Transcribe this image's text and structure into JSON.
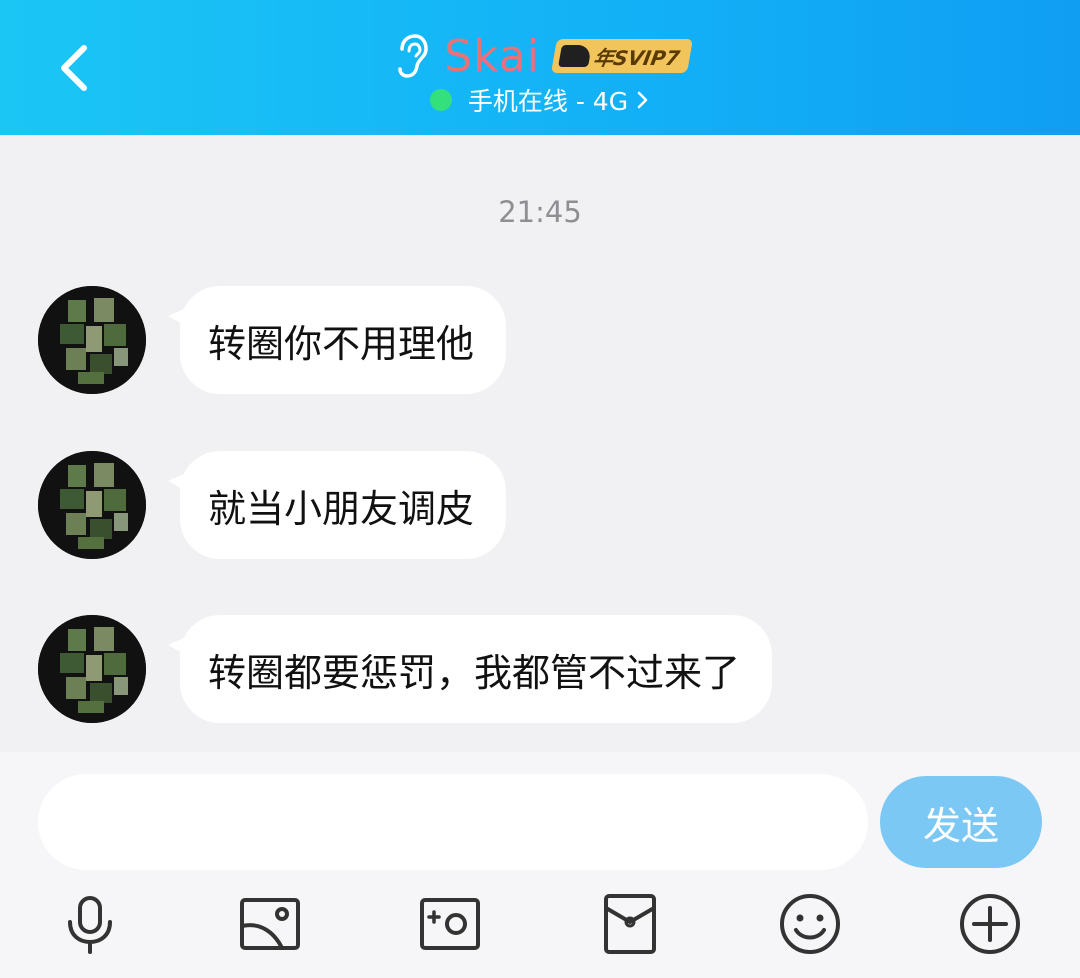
{
  "header": {
    "contact_name": "Skai",
    "vip_badge": "年SVIP7",
    "status": "手机在线 - 4G",
    "status_dot_color": "#34e07b"
  },
  "chat": {
    "timestamp": "21:45",
    "messages": [
      {
        "text": "转圈你不用理他"
      },
      {
        "text": "就当小朋友调皮"
      },
      {
        "text": "转圈都要惩罚，我都管不过来了"
      }
    ]
  },
  "composer": {
    "input_value": "",
    "placeholder": "",
    "send_label": "发送",
    "send_color": "#7cc8f4"
  },
  "toolbar": {
    "icons": [
      "microphone-icon",
      "image-icon",
      "camera-icon",
      "red-packet-icon",
      "emoji-icon",
      "plus-icon"
    ]
  }
}
